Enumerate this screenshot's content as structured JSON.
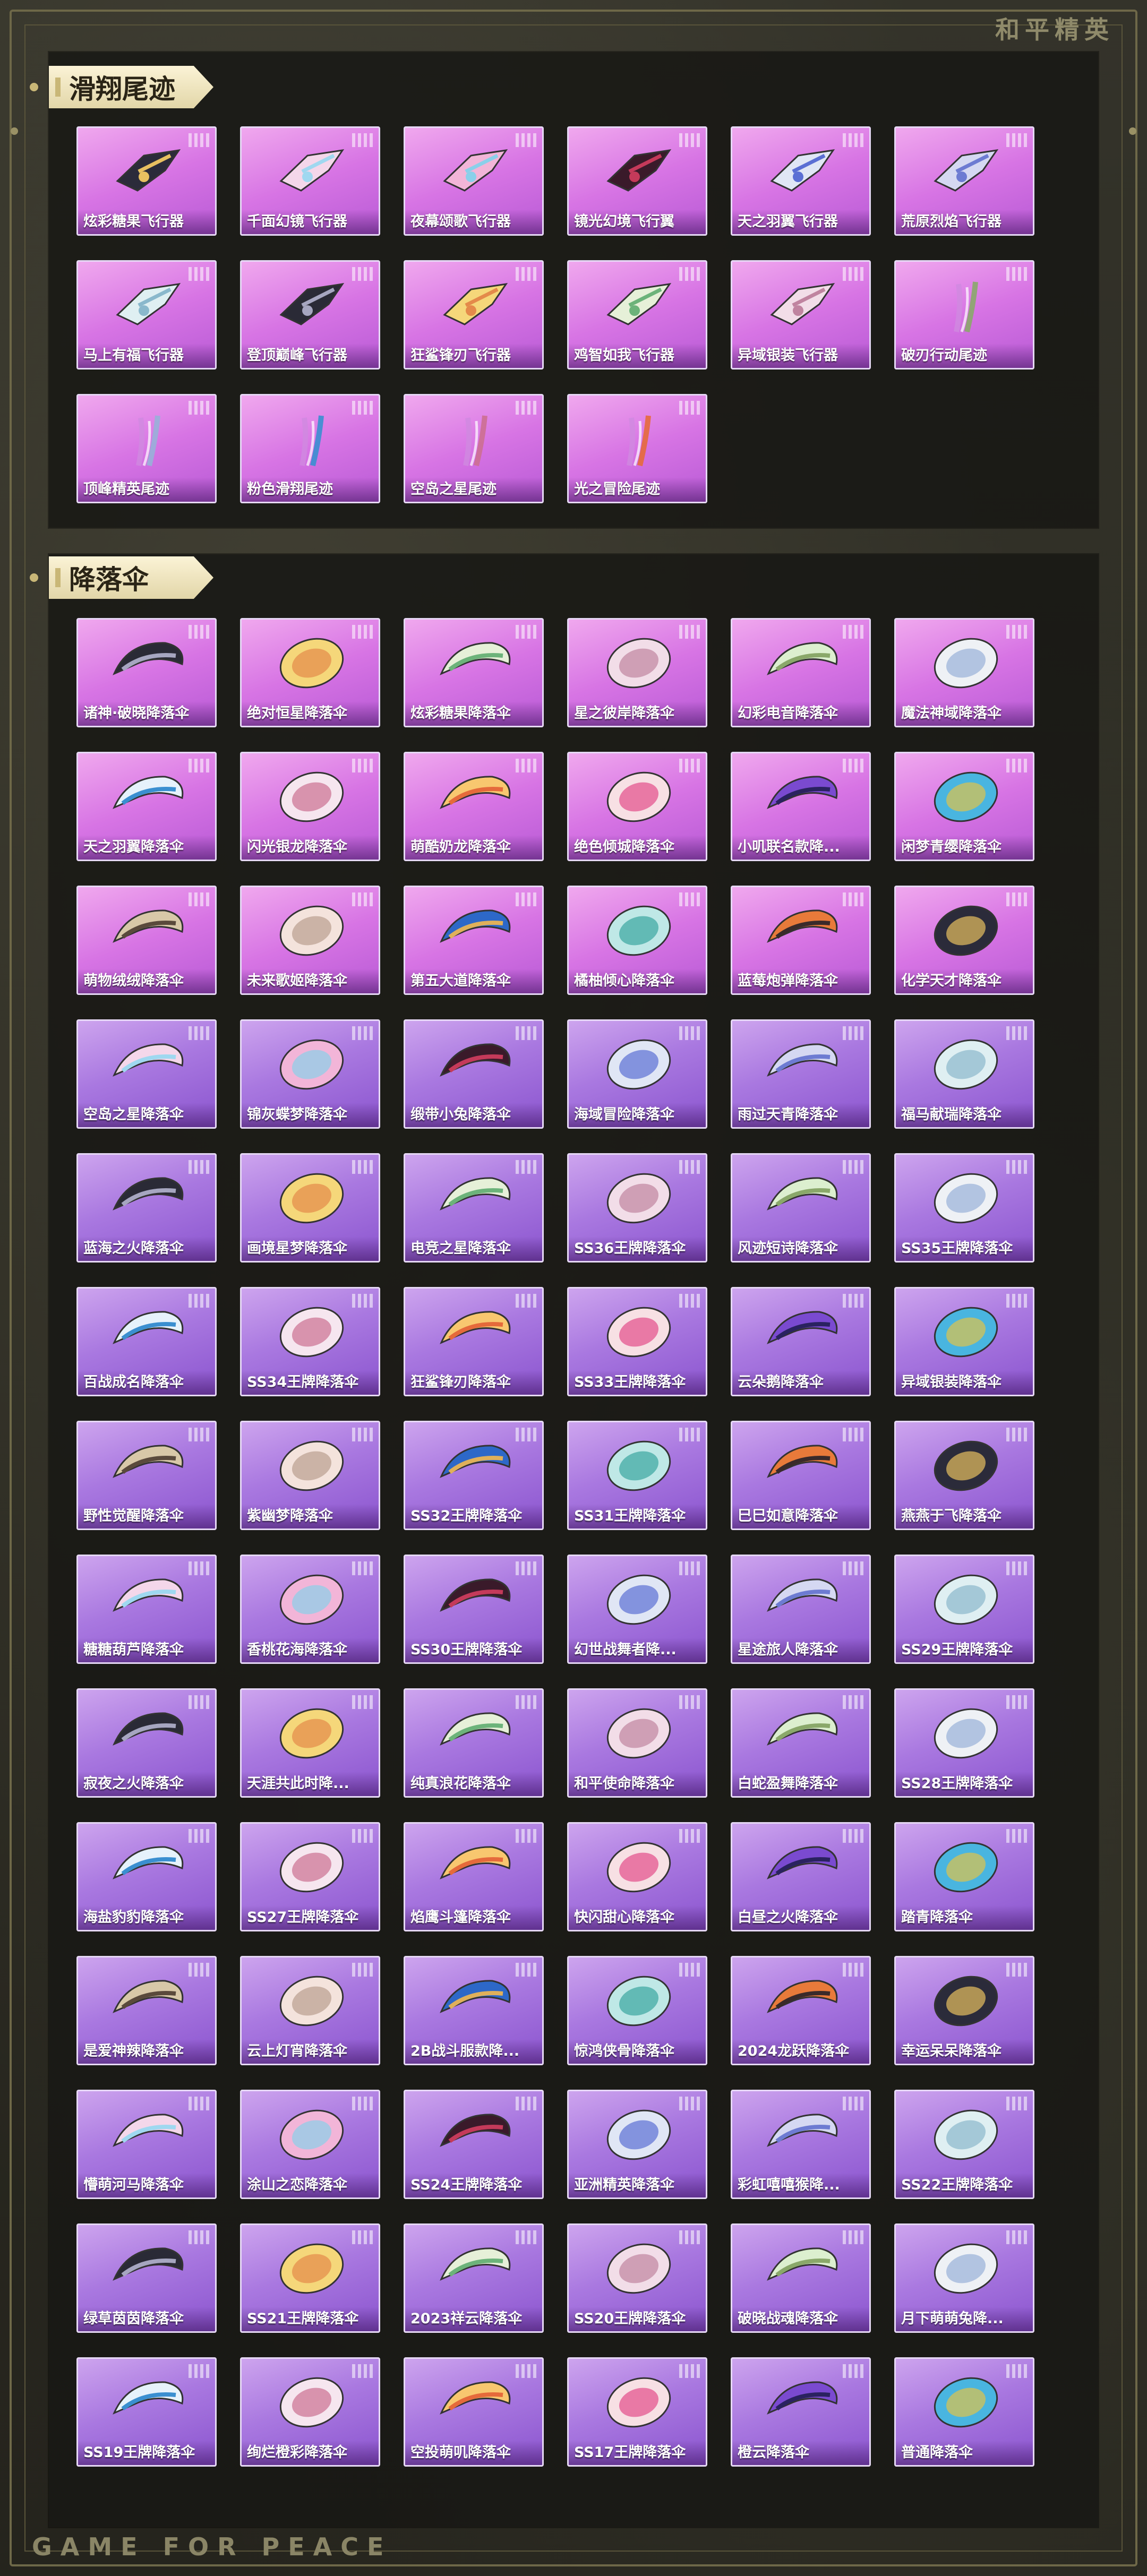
{
  "brand": {
    "top": "和平精英",
    "bottom": "GAME FOR PEACE"
  },
  "sections": [
    {
      "title": "滑翔尾迹",
      "items": [
        {
          "name": "炫彩糖果飞行器",
          "icon": "candy-glider-icon"
        },
        {
          "name": "千面幻镜飞行器",
          "icon": "mirror-glider-icon"
        },
        {
          "name": "夜幕颂歌飞行器",
          "icon": "night-glider-icon"
        },
        {
          "name": "镜光幻境飞行翼",
          "icon": "wing-glider-icon"
        },
        {
          "name": "天之羽翼飞行器",
          "icon": "feather-glider-icon"
        },
        {
          "name": "荒原烈焰飞行器",
          "icon": "flame-glider-icon"
        },
        {
          "name": "马上有福飞行器",
          "icon": "horse-glider-icon"
        },
        {
          "name": "登顶巅峰飞行器",
          "icon": "summit-glider-icon"
        },
        {
          "name": "狂鲨锋刃飞行器",
          "icon": "shark-glider-icon"
        },
        {
          "name": "鸡智如我飞行器",
          "icon": "chicken-glider-icon"
        },
        {
          "name": "异域银装飞行器",
          "icon": "dragon-glider-icon"
        },
        {
          "name": "破刃行动尾迹",
          "icon": "trail-icon"
        },
        {
          "name": "顶峰精英尾迹",
          "icon": "trail-icon"
        },
        {
          "name": "粉色滑翔尾迹",
          "icon": "trail-icon"
        },
        {
          "name": "空岛之星尾迹",
          "icon": "trail-icon"
        },
        {
          "name": "光之冒险尾迹",
          "icon": "trail-icon"
        }
      ]
    },
    {
      "title": "降落伞",
      "items": [
        {
          "name": "诸神·破晓降落伞"
        },
        {
          "name": "绝对恒星降落伞"
        },
        {
          "name": "炫彩糖果降落伞"
        },
        {
          "name": "星之彼岸降落伞"
        },
        {
          "name": "幻彩电音降落伞"
        },
        {
          "name": "魔法神域降落伞"
        },
        {
          "name": "天之羽翼降落伞"
        },
        {
          "name": "闪光银龙降落伞"
        },
        {
          "name": "萌酷奶龙降落伞"
        },
        {
          "name": "绝色倾城降落伞"
        },
        {
          "name": "小叽联名款降..."
        },
        {
          "name": "闲梦青缨降落伞"
        },
        {
          "name": "萌物绒绒降落伞"
        },
        {
          "name": "未来歌姬降落伞"
        },
        {
          "name": "第五大道降落伞"
        },
        {
          "name": "橘柚倾心降落伞"
        },
        {
          "name": "蓝莓炮弹降落伞"
        },
        {
          "name": "化学天才降落伞"
        },
        {
          "name": "空岛之星降落伞"
        },
        {
          "name": "锦灰蝶梦降落伞"
        },
        {
          "name": "缎带小兔降落伞"
        },
        {
          "name": "海域冒险降落伞"
        },
        {
          "name": "雨过天青降落伞"
        },
        {
          "name": "福马献瑞降落伞"
        },
        {
          "name": "蓝海之火降落伞"
        },
        {
          "name": "画境星梦降落伞"
        },
        {
          "name": "电竞之星降落伞"
        },
        {
          "name": "SS36王牌降落伞"
        },
        {
          "name": "风迹短诗降落伞"
        },
        {
          "name": "SS35王牌降落伞"
        },
        {
          "name": "百战成名降落伞"
        },
        {
          "name": "SS34王牌降落伞"
        },
        {
          "name": "狂鲨锋刃降落伞"
        },
        {
          "name": "SS33王牌降落伞"
        },
        {
          "name": "云朵鹅降落伞"
        },
        {
          "name": "异域银装降落伞"
        },
        {
          "name": "野性觉醒降落伞"
        },
        {
          "name": "紫幽梦降落伞"
        },
        {
          "name": "SS32王牌降落伞"
        },
        {
          "name": "SS31王牌降落伞"
        },
        {
          "name": "巳巳如意降落伞"
        },
        {
          "name": "燕燕于飞降落伞"
        },
        {
          "name": "糖糖葫芦降落伞"
        },
        {
          "name": "香桃花海降落伞"
        },
        {
          "name": "SS30王牌降落伞"
        },
        {
          "name": "幻世战舞者降..."
        },
        {
          "name": "星途旅人降落伞"
        },
        {
          "name": "SS29王牌降落伞"
        },
        {
          "name": "寂夜之火降落伞"
        },
        {
          "name": "天涯共此时降..."
        },
        {
          "name": "纯真浪花降落伞"
        },
        {
          "name": "和平使命降落伞"
        },
        {
          "name": "白蛇盈舞降落伞"
        },
        {
          "name": "SS28王牌降落伞"
        },
        {
          "name": "海盐豹豹降落伞"
        },
        {
          "name": "SS27王牌降落伞"
        },
        {
          "name": "焰鹰斗篷降落伞"
        },
        {
          "name": "快闪甜心降落伞"
        },
        {
          "name": "白昼之火降落伞"
        },
        {
          "name": "踏青降落伞"
        },
        {
          "name": "是爱神辣降落伞"
        },
        {
          "name": "云上灯宵降落伞"
        },
        {
          "name": "2B战斗服款降..."
        },
        {
          "name": "惊鸿侠骨降落伞"
        },
        {
          "name": "2024龙跃降落伞"
        },
        {
          "name": "幸运呆呆降落伞"
        },
        {
          "name": "懵萌河马降落伞"
        },
        {
          "name": "涂山之恋降落伞"
        },
        {
          "name": "SS24王牌降落伞"
        },
        {
          "name": "亚洲精英降落伞"
        },
        {
          "name": "彩虹嘻嘻猴降..."
        },
        {
          "name": "SS22王牌降落伞"
        },
        {
          "name": "绿草茵茵降落伞"
        },
        {
          "name": "SS21王牌降落伞"
        },
        {
          "name": "2023祥云降落伞"
        },
        {
          "name": "SS20王牌降落伞"
        },
        {
          "name": "破晓战魂降落伞"
        },
        {
          "name": "月下萌萌兔降..."
        },
        {
          "name": "SS19王牌降落伞"
        },
        {
          "name": "绚烂橙彩降落伞"
        },
        {
          "name": "空投萌叽降落伞"
        },
        {
          "name": "SS17王牌降落伞"
        },
        {
          "name": "橙云降落伞"
        },
        {
          "name": "普通降落伞"
        }
      ]
    }
  ],
  "colors": {
    "accent": "#c9b777",
    "card_pink": "#d27ce6",
    "card_purple": "#a978e0"
  }
}
